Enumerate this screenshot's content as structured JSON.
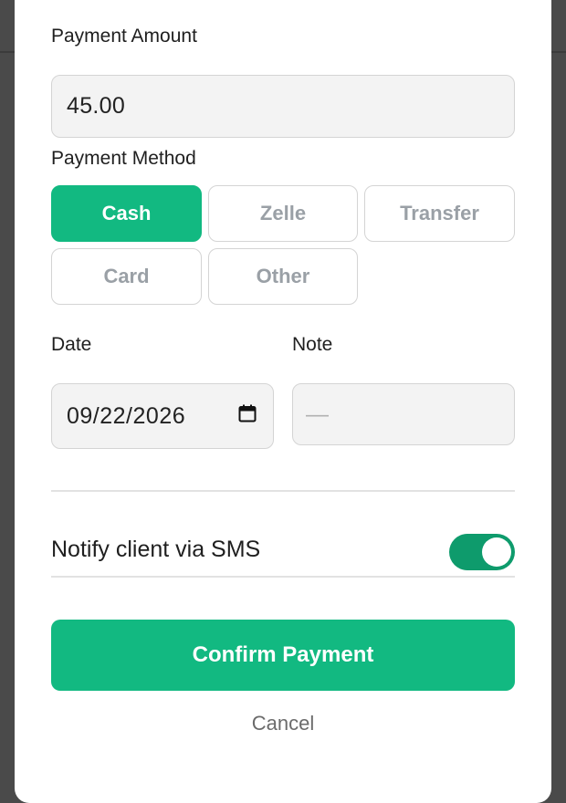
{
  "payment_amount": {
    "label": "Payment Amount",
    "value": "45.00"
  },
  "payment_method": {
    "label": "Payment Method",
    "options": [
      "Cash",
      "Zelle",
      "Transfer",
      "Card",
      "Other"
    ],
    "selected": "Cash"
  },
  "date": {
    "label": "Date",
    "value": "09/22/2026",
    "icon": "calendar-icon"
  },
  "note": {
    "label": "Note",
    "placeholder": "—"
  },
  "sms": {
    "label": "Notify client via SMS",
    "enabled": true
  },
  "actions": {
    "confirm_label": "Confirm Payment",
    "cancel_label": "Cancel"
  },
  "colors": {
    "accent": "#12b981",
    "toggle_on": "#0e9b6c",
    "backdrop": "#4a4a4a"
  }
}
